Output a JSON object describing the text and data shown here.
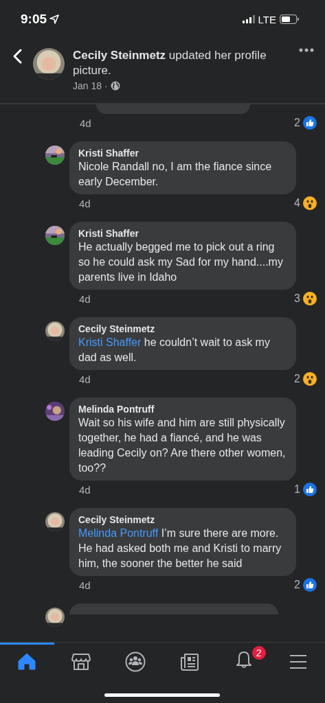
{
  "status_bar": {
    "time": "9:05",
    "network": "LTE"
  },
  "header": {
    "author": "Cecily Steinmetz",
    "action": "updated her profile picture.",
    "date": "Jan 18 ·"
  },
  "comments": [
    {
      "kind": "stub",
      "time": "4d",
      "reaction": {
        "kind": "like",
        "count": "2"
      }
    },
    {
      "kind": "comment",
      "author": "Kristi Shaffer",
      "text": "Nicole Randall no, I am the fiance since early December.",
      "time": "4d",
      "reaction": {
        "kind": "wow",
        "count": "4"
      }
    },
    {
      "kind": "comment",
      "author": "Kristi Shaffer",
      "text": "He actually begged me to pick out a ring so he could ask my Sad for my hand....my parents live in Idaho",
      "time": "4d",
      "reaction": {
        "kind": "wow",
        "count": "3"
      }
    },
    {
      "kind": "comment",
      "author": "Cecily Steinmetz",
      "mention": "Kristi Shaffer",
      "text": "he couldn’t wait to ask my dad as well.",
      "time": "4d",
      "reaction": {
        "kind": "wow",
        "count": "2"
      }
    },
    {
      "kind": "comment",
      "author": "Melinda Pontruff",
      "text": "Wait so his wife and him are still physically together, he had a fiancé, and he was leading Cecily on? Are there other women, too??",
      "time": "4d",
      "reaction": {
        "kind": "like",
        "count": "1"
      }
    },
    {
      "kind": "comment",
      "author": "Cecily Steinmetz",
      "mention": "Melinda Pontruff",
      "text": "I’m sure there are more. He had asked both me and Kristi to marry him, the sooner the better he said",
      "time": "4d",
      "reaction": {
        "kind": "like",
        "count": "2"
      }
    },
    {
      "kind": "partial"
    }
  ],
  "nav": [
    {
      "kind": "home",
      "selected": true
    },
    {
      "kind": "marketplace",
      "selected": false
    },
    {
      "kind": "groups",
      "selected": false
    },
    {
      "kind": "news",
      "selected": false
    },
    {
      "kind": "notifications",
      "selected": false,
      "badge": "2"
    },
    {
      "kind": "menu",
      "selected": false
    }
  ]
}
